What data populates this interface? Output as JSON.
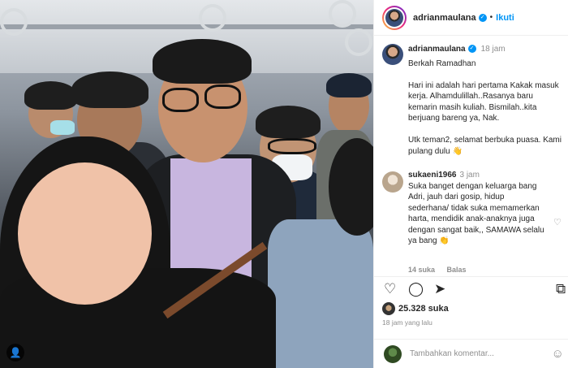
{
  "post": {
    "username": "adrianmaulana",
    "follow_label": "Ikuti",
    "separator": "•"
  },
  "caption": {
    "username": "adrianmaulana",
    "time": "18 jam",
    "text": "Berkah Ramadhan\n\nHari ini adalah hari pertama Kakak masuk kerja. Alhamdulillah..Rasanya baru kemarin masih kuliah. Bismilah..kita berjuang bareng ya, Nak.\n\nUtk teman2, selamat berbuka puasa. Kami pulang dulu 👋"
  },
  "comment": {
    "username": "sukaeni1966",
    "time": "3 jam",
    "text": "Suka banget dengan keluarga bang Adri, jauh dari gosip, hidup sederhana/ tidak suka memamerkan harta, mendidik anak-anaknya juga dengan sangat baik,, SAMAWA selalu ya bang 👏",
    "likes": "14 suka",
    "reply": "Balas"
  },
  "stats": {
    "likes_count": "25.328",
    "likes_word": "suka",
    "posted_ago": "18 jam yang lalu"
  },
  "composer": {
    "placeholder": "Tambahkan komentar..."
  },
  "icons": {
    "heart": "♡",
    "comment": "◯",
    "share": "➤",
    "save": "⧉",
    "emoji": "☺",
    "user": "👤",
    "small_heart": "♡"
  }
}
